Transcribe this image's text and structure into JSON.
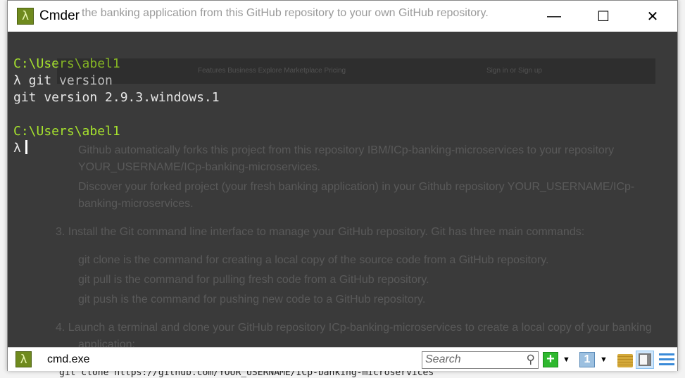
{
  "background_doc": {
    "top_line": "the banking application from this GitHub repository to your own GitHub repository.",
    "bullet1": "Github automatically forks this project from this repository IBM/ICp-banking-microservices to your repository",
    "bullet1b": "YOUR_USERNAME/ICp-banking-microservices.",
    "bullet2": "Discover your forked project (your fresh banking application) in your Github repository YOUR_USERNAME/ICp-",
    "bullet2b": "banking-microservices.",
    "step3": "3. Install the Git command line interface to manage your GitHub repository. Git has three main commands:",
    "clone": "git clone is the command for creating a local copy of the source code from a GitHub repository.",
    "pull": "git pull is the command for pulling fresh code from a GitHub repository.",
    "push": "git push is the command for pushing new code to a GitHub repository.",
    "step4": "4. Launch a terminal and clone your GitHub repository ICp-banking-microservices to create a local copy of your banking",
    "step4b": "application:",
    "code": "git clone https://github.com/YOUR_USERNAME/ICp-banking-microservices",
    "gh_nav": "Features   Business   Explore   Marketplace   Pricing",
    "gh_sign": "Sign in  or  Sign up"
  },
  "window": {
    "title": "Cmder",
    "icon": "lambda-icon",
    "minimize": "—",
    "maximize": "☐",
    "close": "✕"
  },
  "terminal": {
    "lines": [
      {
        "type": "prompt",
        "text": "C:\\Users\\abel1"
      },
      {
        "type": "cmd",
        "text": "λ git version"
      },
      {
        "type": "out",
        "text": "git version 2.9.3.windows.1"
      },
      {
        "type": "out",
        "text": ""
      },
      {
        "type": "prompt",
        "text": "C:\\Users\\abel1"
      },
      {
        "type": "cmd",
        "text": "λ"
      }
    ],
    "prompt_color": "#a6e22e"
  },
  "statusbar": {
    "tab_label": "cmd.exe",
    "search_placeholder": "Search",
    "buttons": [
      "new-console",
      "new-console-menu",
      "tab-number",
      "tab-menu",
      "lock",
      "split-view",
      "menu"
    ],
    "tab_number": "1"
  }
}
